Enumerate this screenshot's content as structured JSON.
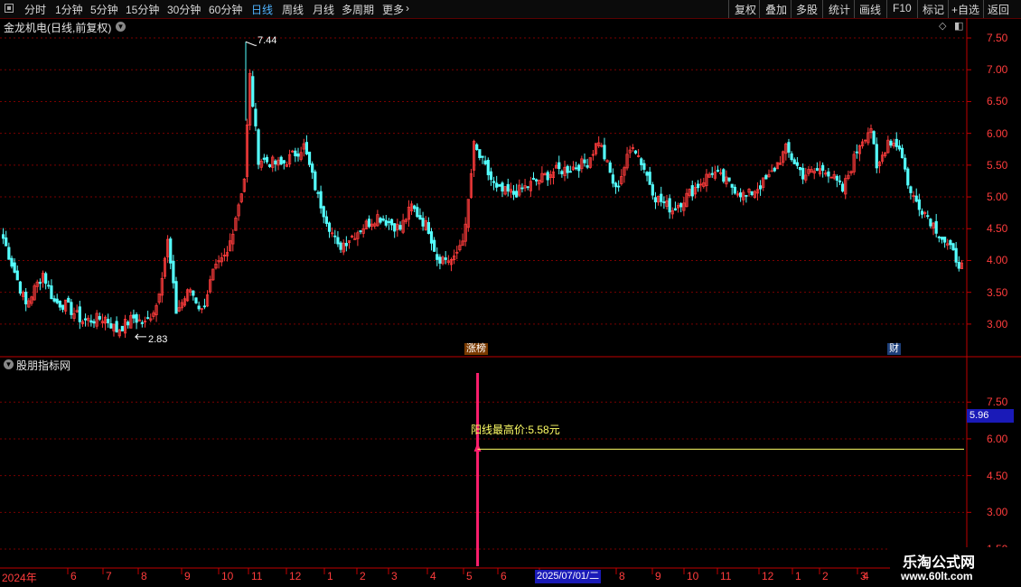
{
  "toolbar": {
    "periods": [
      {
        "label": "分时",
        "active": false
      },
      {
        "label": "1分钟",
        "active": false
      },
      {
        "label": "5分钟",
        "active": false
      },
      {
        "label": "15分钟",
        "active": false
      },
      {
        "label": "30分钟",
        "active": false
      },
      {
        "label": "60分钟",
        "active": false
      },
      {
        "label": "日线",
        "active": true
      },
      {
        "label": "周线",
        "active": false
      },
      {
        "label": "月线",
        "active": false
      },
      {
        "label": "多周期",
        "active": false
      },
      {
        "label": "更多",
        "active": false
      }
    ],
    "more_arrow": "›",
    "actions": [
      "复权",
      "叠加",
      "多股",
      "统计",
      "画线",
      "F10",
      "标记",
      "+自选",
      "返回"
    ]
  },
  "main_panel": {
    "title": "金龙机电(日线,前复权)",
    "high_label": "7.44",
    "low_label": "2.83",
    "badge_left": "涨榜",
    "badge_right": "财",
    "y_ticks": [
      "7.50",
      "7.00",
      "6.50",
      "6.00",
      "5.50",
      "5.00",
      "4.50",
      "4.00",
      "3.50",
      "3.00"
    ]
  },
  "indicator_panel": {
    "title": "股朋指标网",
    "annotation": "阳线最高价:5.58元",
    "price_box": "5.96",
    "y_ticks": [
      "7.50",
      "6.00",
      "4.50",
      "3.00",
      "1.50"
    ]
  },
  "x_axis": {
    "labels": [
      "2024年",
      "6",
      "7",
      "8",
      "9",
      "10",
      "11",
      "12",
      "1",
      "2",
      "3",
      "4",
      "5",
      "6",
      "7",
      "8",
      "9",
      "10",
      "11",
      "12",
      "1",
      "2",
      "3",
      "4"
    ],
    "date_box": "2025/07/01/二"
  },
  "watermark": {
    "line1": "乐淘公式网",
    "line2": "www.60lt.com"
  },
  "colors": {
    "up": "#ff3c3c",
    "down": "#54ffff",
    "grid": "#7a0000",
    "axis": "#c00000",
    "annotation": "#ffff66",
    "signal": "#ff1f6e"
  },
  "chart_data": {
    "type": "candlestick",
    "anchors": [
      [
        0,
        4.35
      ],
      [
        8,
        3.3
      ],
      [
        14,
        3.8
      ],
      [
        18,
        3.35
      ],
      [
        22,
        3.3
      ],
      [
        28,
        3.05
      ],
      [
        36,
        3.1
      ],
      [
        40,
        2.9
      ],
      [
        46,
        3.1
      ],
      [
        50,
        3.0
      ],
      [
        54,
        3.3
      ],
      [
        58,
        4.3
      ],
      [
        61,
        3.2
      ],
      [
        66,
        3.55
      ],
      [
        70,
        3.2
      ],
      [
        74,
        3.8
      ],
      [
        79,
        4.1
      ],
      [
        85,
        5.3
      ],
      [
        87,
        6.9
      ],
      [
        90,
        5.6
      ],
      [
        98,
        5.5
      ],
      [
        106,
        5.8
      ],
      [
        111,
        5.0
      ],
      [
        118,
        4.2
      ],
      [
        126,
        4.5
      ],
      [
        132,
        4.7
      ],
      [
        136,
        4.6
      ],
      [
        140,
        4.5
      ],
      [
        144,
        4.85
      ],
      [
        150,
        4.5
      ],
      [
        153,
        4.05
      ],
      [
        159,
        4.0
      ],
      [
        163,
        4.5
      ],
      [
        166,
        5.8
      ],
      [
        174,
        5.1
      ],
      [
        180,
        5.05
      ],
      [
        186,
        5.2
      ],
      [
        194,
        5.4
      ],
      [
        200,
        5.45
      ],
      [
        206,
        5.55
      ],
      [
        210,
        5.9
      ],
      [
        216,
        5.1
      ],
      [
        222,
        5.85
      ],
      [
        226,
        5.45
      ],
      [
        230,
        5.0
      ],
      [
        236,
        4.8
      ],
      [
        243,
        5.1
      ],
      [
        250,
        5.4
      ],
      [
        256,
        5.2
      ],
      [
        262,
        5.0
      ],
      [
        270,
        5.3
      ],
      [
        276,
        5.75
      ],
      [
        282,
        5.35
      ],
      [
        290,
        5.45
      ],
      [
        296,
        5.1
      ],
      [
        302,
        5.85
      ],
      [
        306,
        6.1
      ],
      [
        308,
        5.4
      ],
      [
        312,
        5.9
      ],
      [
        316,
        5.8
      ],
      [
        320,
        5.05
      ],
      [
        326,
        4.7
      ],
      [
        332,
        4.3
      ],
      [
        338,
        3.9
      ]
    ],
    "ylim": [
      2.7,
      7.6
    ],
    "y_ticks": [
      7.5,
      7.0,
      6.5,
      6.0,
      5.5,
      5.0,
      4.5,
      4.0,
      3.5,
      3.0
    ],
    "high": 7.44,
    "low": 2.83,
    "indicator": {
      "annotation_value": 5.58,
      "ylim": [
        0.8,
        8.8
      ],
      "y_ticks": [
        7.5,
        6.0,
        4.5,
        3.0,
        1.5
      ],
      "signal_position": 0.494
    }
  }
}
